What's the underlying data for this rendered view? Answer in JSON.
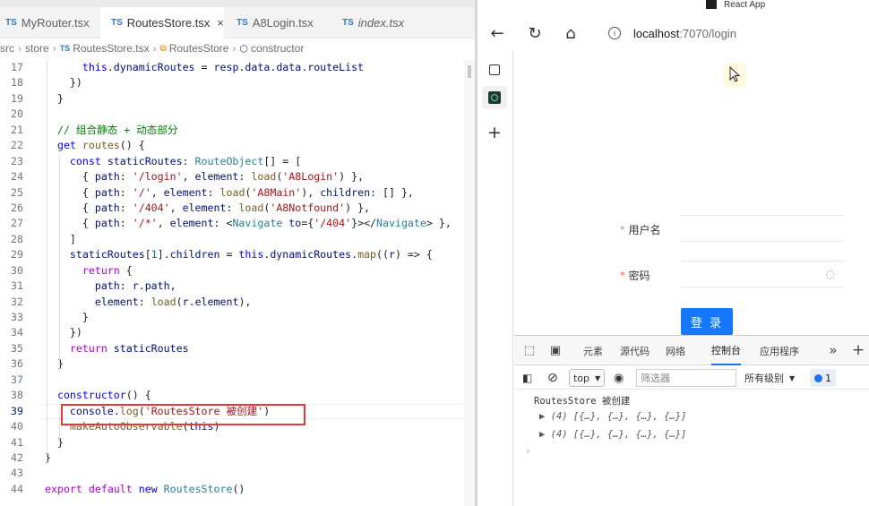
{
  "editor": {
    "tabs": [
      {
        "label": "MyRouter.tsx",
        "lang": "TS"
      },
      {
        "label": "RoutesStore.tsx",
        "lang": "TS",
        "close": "×"
      },
      {
        "label": "A8Login.tsx",
        "lang": "TS"
      },
      {
        "label": "index.tsx",
        "lang": "TS"
      }
    ],
    "breadcrumb": {
      "parts": [
        "src",
        "store"
      ],
      "file_lang": "TS",
      "file": "RoutesStore.tsx",
      "class_icon": "class-icon",
      "class": "RoutesStore",
      "member_icon": "cube-icon",
      "member": "constructor"
    },
    "code_lines": [
      {
        "n": "17",
        "text": "      this.dynamicRoutes = resp.data.data.routeList"
      },
      {
        "n": "18",
        "text": "    })"
      },
      {
        "n": "19",
        "text": "  }"
      },
      {
        "n": "20",
        "text": ""
      },
      {
        "n": "21",
        "text": "  // 组合静态 + 动态部分"
      },
      {
        "n": "22",
        "text": "  get routes() {"
      },
      {
        "n": "23",
        "text": "    const staticRoutes: RouteObject[] = ["
      },
      {
        "n": "24",
        "text": "      { path: '/login', element: load('A8Login') },"
      },
      {
        "n": "25",
        "text": "      { path: '/', element: load('A8Main'), children: [] },"
      },
      {
        "n": "26",
        "text": "      { path: '/404', element: load('A8Notfound') },"
      },
      {
        "n": "27",
        "text": "      { path: '/*', element: <Navigate to={'/404'}></Navigate> },"
      },
      {
        "n": "28",
        "text": "    ]"
      },
      {
        "n": "29",
        "text": "    staticRoutes[1].children = this.dynamicRoutes.map((r) => {"
      },
      {
        "n": "30",
        "text": "      return {"
      },
      {
        "n": "31",
        "text": "        path: r.path,"
      },
      {
        "n": "32",
        "text": "        element: load(r.element),"
      },
      {
        "n": "33",
        "text": "      }"
      },
      {
        "n": "34",
        "text": "    })"
      },
      {
        "n": "35",
        "text": "    return staticRoutes"
      },
      {
        "n": "36",
        "text": "  }"
      },
      {
        "n": "37",
        "text": ""
      },
      {
        "n": "38",
        "text": "  constructor() {"
      },
      {
        "n": "39",
        "text": "    console.log('RoutesStore 被创建')"
      },
      {
        "n": "40",
        "text": "    makeAutoObservable(this)"
      },
      {
        "n": "41",
        "text": "  }"
      },
      {
        "n": "42",
        "text": "}"
      },
      {
        "n": "43",
        "text": ""
      },
      {
        "n": "44",
        "text": "export default new RoutesStore()"
      }
    ],
    "highlight_color": "#e53935"
  },
  "browser": {
    "window_title": "React App",
    "nav": {
      "back": "←",
      "reload": "↻",
      "home": "⌂"
    },
    "url": {
      "host": "localhost",
      "rest": ":7070/login",
      "info": "i"
    },
    "side_tabs": {
      "add": "+"
    },
    "form": {
      "username_label": "用户名",
      "password_label": "密码",
      "required_mark": "*",
      "eye": "◌",
      "login_button": "登 录"
    }
  },
  "devtools": {
    "tabs": [
      "元素",
      "源代码",
      "网络",
      "控制台",
      "应用程序"
    ],
    "active_tab": "控制台",
    "more": "»",
    "add": "+",
    "toolbar": {
      "context": "top",
      "filter_placeholder": "筛选器",
      "levels": "所有级别",
      "issues_count": "1"
    },
    "console_lines": [
      "RoutesStore 被创建",
      "▶ (4) [{…}, {…}, {…}, {…}]",
      "▶ (4) [{…}, {…}, {…}, {…}]"
    ],
    "prompt": "›"
  }
}
